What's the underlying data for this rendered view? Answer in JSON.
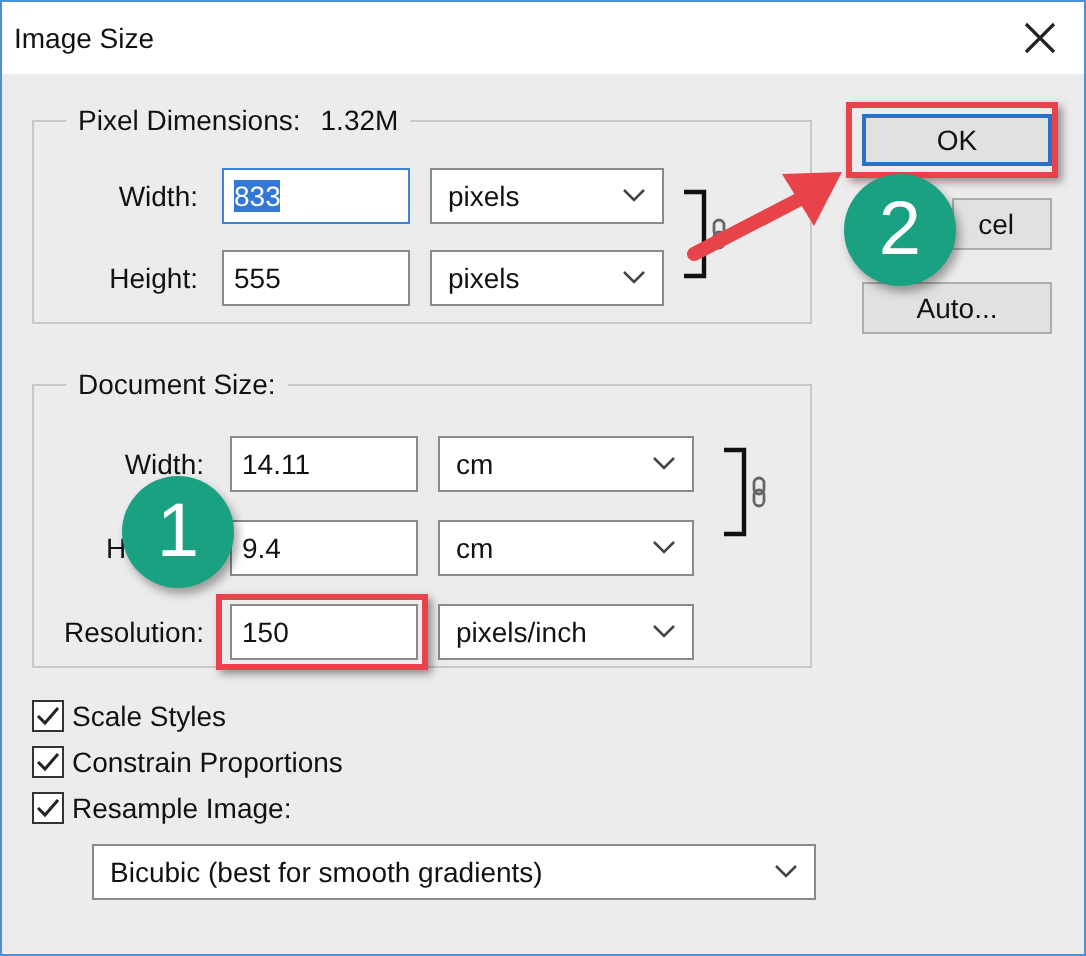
{
  "window": {
    "title": "Image Size"
  },
  "pixel_dimensions": {
    "legend": "Pixel Dimensions:",
    "value": "1.32M",
    "rows": [
      {
        "label": "Width:",
        "value": "833",
        "selected": true,
        "unit": "pixels"
      },
      {
        "label": "Height:",
        "value": "555",
        "selected": false,
        "unit": "pixels"
      }
    ]
  },
  "document_size": {
    "legend": "Document Size:",
    "rows": [
      {
        "label": "Width:",
        "label_cut": false,
        "value": "14.11",
        "unit": "cm",
        "highlighted": false
      },
      {
        "label": "H",
        "label_cut": true,
        "value": "9.4",
        "unit": "cm",
        "highlighted": false
      },
      {
        "label": "Resolution:",
        "label_cut": false,
        "value": "150",
        "unit": "pixels/inch",
        "highlighted": true
      }
    ]
  },
  "options": [
    {
      "label": "Scale Styles",
      "checked": true
    },
    {
      "label": "Constrain Proportions",
      "checked": true
    },
    {
      "label": "Resample Image:",
      "checked": true
    }
  ],
  "resample": "Bicubic (best for smooth gradients)",
  "buttons": [
    {
      "label": "OK",
      "highlighted": true
    },
    {
      "label": "cel",
      "highlighted": false
    },
    {
      "label": "Auto...",
      "highlighted": false
    }
  ],
  "callouts": [
    {
      "number": "1"
    },
    {
      "number": "2"
    }
  ]
}
